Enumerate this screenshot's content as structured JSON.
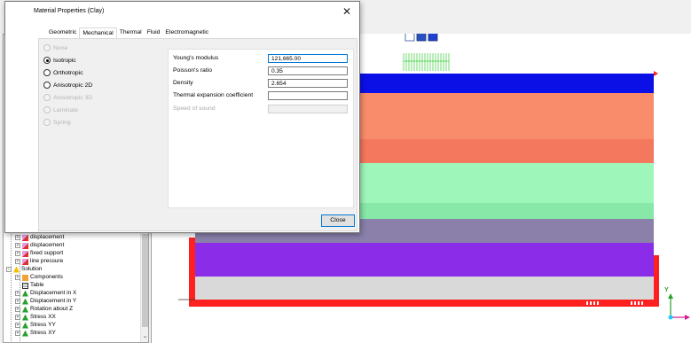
{
  "dialog": {
    "title": "Material Properties (Clay)",
    "close_icon": "close-icon",
    "tabs": [
      "Geometric",
      "Mechanical",
      "Thermal",
      "Fluid",
      "Electromagnetic"
    ],
    "active_tab": "Mechanical",
    "models": [
      {
        "label": "None",
        "checked": false,
        "enabled": false
      },
      {
        "label": "Isotropic",
        "checked": true,
        "enabled": true
      },
      {
        "label": "Orthotropic",
        "checked": false,
        "enabled": true
      },
      {
        "label": "Anisotropic 2D",
        "checked": false,
        "enabled": true
      },
      {
        "label": "Anisotropic 3D",
        "checked": false,
        "enabled": false
      },
      {
        "label": "Laminate",
        "checked": false,
        "enabled": false
      },
      {
        "label": "Spring",
        "checked": false,
        "enabled": false
      }
    ],
    "properties": [
      {
        "label": "Young's modulus",
        "value": "121,665.00",
        "enabled": true,
        "focused": true
      },
      {
        "label": "Poisson's ratio",
        "value": "0.35",
        "enabled": true,
        "focused": false
      },
      {
        "label": "Density",
        "value": "2.654",
        "enabled": true,
        "focused": false
      },
      {
        "label": "Thermal expansion coefficient",
        "value": "",
        "enabled": true,
        "focused": false
      },
      {
        "label": "Speed of sound",
        "value": "",
        "enabled": false,
        "focused": false
      }
    ],
    "close_button": "Close"
  },
  "tree": {
    "items": [
      {
        "label": "displacement",
        "icon": "boundary-condition-icon"
      },
      {
        "label": "displacement",
        "icon": "boundary-condition-icon"
      },
      {
        "label": "fixed support",
        "icon": "boundary-condition-icon"
      },
      {
        "label": "line pressure",
        "icon": "boundary-condition-icon"
      },
      {
        "label": "Solution",
        "icon": "solution-icon"
      },
      {
        "label": "Components",
        "icon": "components-icon"
      },
      {
        "label": "Table",
        "icon": "table-icon"
      },
      {
        "label": "Displacement in X",
        "icon": "result-icon"
      },
      {
        "label": "Displacement in Y",
        "icon": "result-icon"
      },
      {
        "label": "Rotation about Z",
        "icon": "result-icon"
      },
      {
        "label": "Stress XX",
        "icon": "result-icon"
      },
      {
        "label": "Stress YY",
        "icon": "result-icon"
      },
      {
        "label": "Stress XY",
        "icon": "result-icon"
      }
    ]
  },
  "viewport": {
    "axis_y": "Y",
    "layers": [
      {
        "name": "layer-blue",
        "color": "#0a10e6"
      },
      {
        "name": "layer-salmon",
        "color": "#f98c6a"
      },
      {
        "name": "layer-salmon-dark",
        "color": "#f4785e"
      },
      {
        "name": "layer-mint",
        "color": "#9ff6bb"
      },
      {
        "name": "layer-mint-dark",
        "color": "#88e8a8"
      },
      {
        "name": "layer-slate",
        "color": "#8a80aa"
      },
      {
        "name": "layer-violet",
        "color": "#8a2ce8"
      },
      {
        "name": "layer-grey",
        "color": "#d9d9d9"
      }
    ]
  }
}
